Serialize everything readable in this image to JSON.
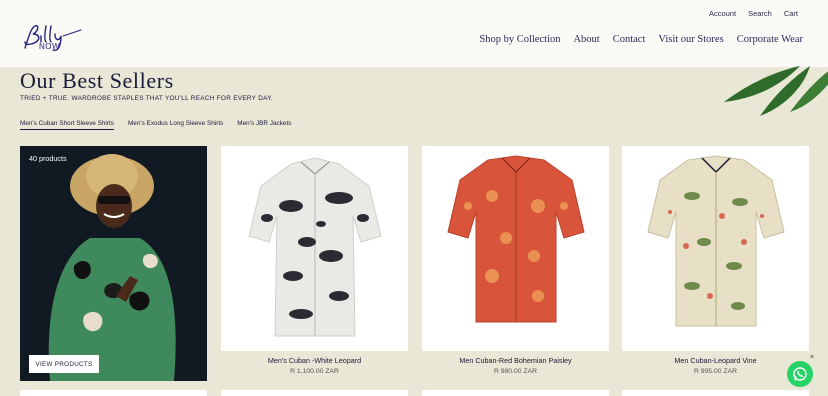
{
  "header": {
    "logo": {
      "script": "Billy",
      "sub": "NOW"
    },
    "utility": [
      "Account",
      "Search",
      "Cart"
    ],
    "nav": [
      "Shop by Collection",
      "About",
      "Contact",
      "Visit our Stores",
      "Corporate Wear"
    ]
  },
  "section": {
    "title": "Our Best Sellers",
    "subtitle": "TRIED + TRUE. WARDROBE STAPLES THAT YOU'LL REACH FOR EVERY DAY.",
    "tabs": [
      "Men's Cuban Short Sleeve Shirts",
      "Men's Exodus Long Sleeve Shirts",
      "Men's JBR Jackets"
    ],
    "active_tab": 0
  },
  "promo": {
    "count": "40 products",
    "button": "VIEW PRODUCTS"
  },
  "products": [
    {
      "name": "Men's Cuban -White Leopard",
      "price": "R 1,100.00 ZAR"
    },
    {
      "name": "Men Cuban-Red Bohemian Paisley",
      "price": "R 980.00 ZAR"
    },
    {
      "name": "Men Cuban-Leopard Vine",
      "price": "R 995.00 ZAR"
    }
  ],
  "whatsapp": {
    "close": "×"
  },
  "colors": {
    "page_bg": "#e9e7d6",
    "header_bg": "#fbfaf7",
    "navy": "#1b1b3a",
    "whatsapp": "#25d366",
    "leaf": "#2f6b2b"
  }
}
